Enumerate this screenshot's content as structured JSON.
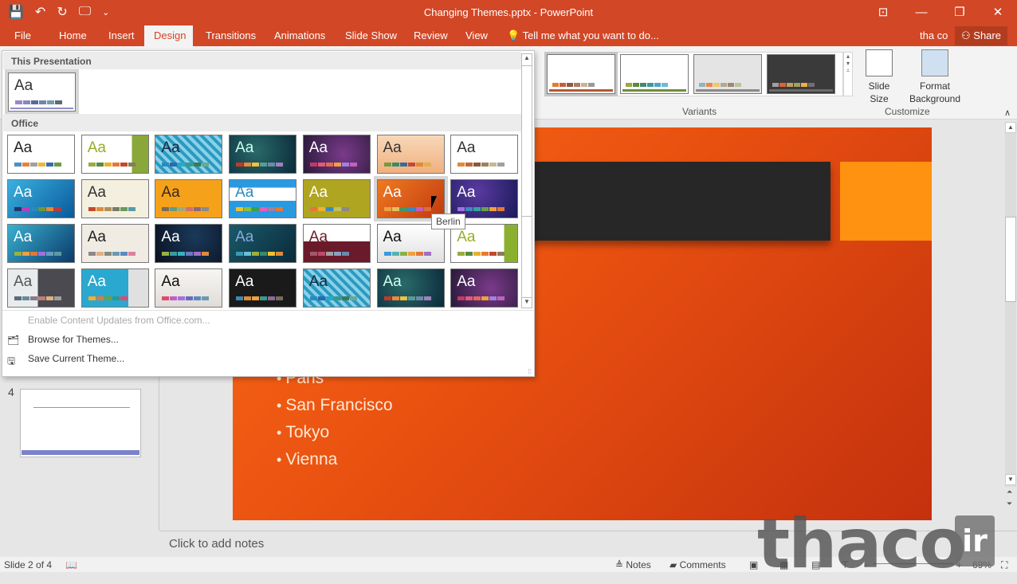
{
  "window": {
    "title": "Changing Themes.pptx - PowerPoint",
    "controls": [
      "ribbon-display-options",
      "minimize",
      "restore",
      "close"
    ]
  },
  "qat": {
    "save": "💾",
    "undo": "↶",
    "redo": "↻",
    "present": "🖵",
    "customize": "⌄"
  },
  "tabs": [
    {
      "label": "File"
    },
    {
      "label": "Home"
    },
    {
      "label": "Insert"
    },
    {
      "label": "Design",
      "active": true
    },
    {
      "label": "Transitions"
    },
    {
      "label": "Animations"
    },
    {
      "label": "Slide Show"
    },
    {
      "label": "Review"
    },
    {
      "label": "View"
    }
  ],
  "tellme": "Tell me what you want to do...",
  "user": "tha co",
  "share": "Share",
  "ribbon": {
    "variants_label": "Variants",
    "customize_label": "Customize",
    "slide_size": "Slide Size",
    "format_background": "Format Background",
    "variants": [
      {
        "bg": "#ffffff",
        "bar": "#b35a36",
        "swatches": [
          "#e87a2c",
          "#c0603a",
          "#8f5a40",
          "#a87d5e",
          "#c8b48f",
          "#999999"
        ]
      },
      {
        "bg": "#ffffff",
        "bar": "#6f8e3a",
        "swatches": [
          "#9aab3f",
          "#5c8a3e",
          "#3e8a72",
          "#3a9a9a",
          "#4aa6c9",
          "#6cb8e0"
        ]
      },
      {
        "bg": "#e4e4e4",
        "bar": "#8a8a8a",
        "swatches": [
          "#8fb4c4",
          "#e88a4a",
          "#f0c86a",
          "#b0a890",
          "#a08870",
          "#c0c0a0"
        ]
      },
      {
        "bg": "#3a3a3a",
        "bar": "#6a6a6a",
        "swatches": [
          "#a0a0a0",
          "#e0603a",
          "#c0a060",
          "#a0a060",
          "#f0b040",
          "#707070"
        ]
      }
    ]
  },
  "gallery": {
    "this_presentation": "This Presentation",
    "office": "Office",
    "current_theme": {
      "bg": "#ffffff",
      "fg": "#333",
      "bar": "#8b8fc8",
      "swatches": [
        "#9a88c8",
        "#8a88c0",
        "#5a6a9a",
        "#6a8aa8",
        "#7a9aa8",
        "#606a78"
      ]
    },
    "themes": [
      {
        "bg": "#ffffff",
        "fg": "#222",
        "swatches": [
          "#4a90c8",
          "#e8823a",
          "#a0a0a0",
          "#f0b830",
          "#3a6ab0",
          "#6a9a4a"
        ]
      },
      {
        "bg": "linear-gradient(90deg,#fff 75%,#8aa83a 75%)",
        "fg": "#9aab2a",
        "swatches": [
          "#9aab3f",
          "#5c8a3e",
          "#e8b030",
          "#e87a30",
          "#c04a30",
          "#8a7a5a"
        ]
      },
      {
        "bg": "repeating-linear-gradient(45deg,#2a9ac0 0 4px,#8ad0e8 4px 8px)",
        "fg": "#1a2a3a",
        "swatches": [
          "#2a8ac0",
          "#2a6ab0",
          "#2aa8c8",
          "#3a9a8a",
          "#3a7a5a",
          "#6aa898"
        ]
      },
      {
        "bg": "radial-gradient(circle at 40% 40%,#2a6a6a,#0a2a3a)",
        "fg": "#cfe",
        "swatches": [
          "#c03a2a",
          "#e88a3a",
          "#f0c040",
          "#5a9a9a",
          "#6a8aa8",
          "#a080c0"
        ]
      },
      {
        "bg": "radial-gradient(circle at 60% 50%,#7a3a8a,#2a1a3a)",
        "fg": "#fff",
        "swatches": [
          "#c03a6a",
          "#e05a7a",
          "#e06a5a",
          "#f0a040",
          "#a080e0",
          "#c060c0"
        ]
      },
      {
        "bg": "linear-gradient(180deg,#f8d8b8,#f0b080)",
        "fg": "#333",
        "swatches": [
          "#7a9a3a",
          "#3a8a6a",
          "#3a6a9a",
          "#c04a3a",
          "#e08a3a",
          "#e0b050"
        ]
      },
      {
        "bg": "#ffffff",
        "fg": "#333",
        "swatches": [
          "#e08a3a",
          "#c06a3a",
          "#8a5a40",
          "#a08060",
          "#c8b890",
          "#a0a0a0"
        ]
      },
      {
        "bg": "linear-gradient(135deg,#3ab0e0,#0a5a9a)",
        "fg": "#fff",
        "swatches": [
          "#1a3a6a",
          "#c03ac0",
          "#2a8ac0",
          "#6a9a3a",
          "#e08a3a",
          "#c03a3a"
        ]
      },
      {
        "bg": "#f4f0e0",
        "fg": "#333",
        "swatches": [
          "#c04a2a",
          "#e08a3a",
          "#b0905a",
          "#7a7a6a",
          "#6a9a5a",
          "#5a9aa8"
        ]
      },
      {
        "bg": "#f5a21a",
        "fg": "#3a2a1a",
        "swatches": [
          "#7a6a5a",
          "#6a9a7a",
          "#9aaa7a",
          "#d07070",
          "#8a6a7a",
          "#8a8a8a"
        ]
      },
      {
        "bg": "linear-gradient(180deg,#2a9ae0 20%,#fff 20%,#fff 55%,#2a9ae0 55%)",
        "fg": "#2a8ac0",
        "swatches": [
          "#f0c030",
          "#8ac03a",
          "#3aa04a",
          "#e060c0",
          "#a080a0",
          "#e07a3a"
        ]
      },
      {
        "bg": "#b0a520",
        "fg": "#fff",
        "swatches": [
          "#e07a3a",
          "#f0b030",
          "#3a8ac0",
          "#c0c060",
          "#8a8a8a"
        ]
      },
      {
        "bg": "linear-gradient(135deg,#f07a20,#c03a10)",
        "fg": "#fff",
        "swatches": [
          "#f0a040",
          "#e0c060",
          "#3a9a6a",
          "#3a8ac0",
          "#c060c0",
          "#e06a3a"
        ]
      },
      {
        "bg": "radial-gradient(circle at 40% 30%,#5a3aa0,#1a1a5a)",
        "fg": "#fff",
        "swatches": [
          "#a070e0",
          "#3a8ac0",
          "#3aa0a0",
          "#6aa04a",
          "#f0a040",
          "#e07a3a"
        ]
      },
      {
        "bg": "linear-gradient(135deg,#3ab0d0,#0a3a6a)",
        "fg": "#fff",
        "swatches": [
          "#9ab040",
          "#f0a040",
          "#e07a3a",
          "#a070e0",
          "#6a9ac0",
          "#5a9aa0"
        ]
      },
      {
        "bg": "#f0ece4",
        "fg": "#222",
        "swatches": [
          "#8a8a8a",
          "#e0b080",
          "#8a8a7a",
          "#6a9ab0",
          "#5a8ac0",
          "#e080a0"
        ]
      },
      {
        "bg": "radial-gradient(circle at 60% 30%,#1a3a5a,#0a1020)",
        "fg": "#fff",
        "swatches": [
          "#9ab040",
          "#3a9aa0",
          "#3ab0c0",
          "#6a7ac0",
          "#a070c0",
          "#e08a3a"
        ]
      },
      {
        "bg": "linear-gradient(135deg,#1a5a6a,#0a2a3a)",
        "fg": "#8ad",
        "swatches": [
          "#3a9ab0",
          "#6ac0d0",
          "#9ab040",
          "#3a8a6a",
          "#f0c030",
          "#e08a3a"
        ]
      },
      {
        "bg": "linear-gradient(180deg,#fff 45%,#6a1a2a 45%)",
        "fg": "#6a1a2a",
        "swatches": [
          "#a05a6a",
          "#c04a6a",
          "#a0a0a0",
          "#8aa0c0",
          "#6a8ab0"
        ]
      },
      {
        "bg": "linear-gradient(180deg,#fff,#e0e0e0)",
        "fg": "#111",
        "swatches": [
          "#3a9ae0",
          "#5ab0b0",
          "#8ab04a",
          "#f0a040",
          "#e07a3a",
          "#a070c0"
        ]
      },
      {
        "bg": "linear-gradient(90deg,#fff 80%,#8ab030 80%)",
        "fg": "#9aab2a",
        "swatches": [
          "#9aab3f",
          "#5c8a3e",
          "#e8b030",
          "#e87a30",
          "#c04a30",
          "#8a7a5a"
        ]
      },
      {
        "bg": "linear-gradient(90deg,#e8ecec 45%,#4a4a50 45%)",
        "fg": "#555",
        "swatches": [
          "#5a6a7a",
          "#6a8a9a",
          "#8a7a8a",
          "#c07a7a",
          "#e0b080",
          "#a0a0a0"
        ]
      },
      {
        "bg": "linear-gradient(90deg,#2aa8d0 70%,#e0e0e0 70%)",
        "fg": "#fff",
        "swatches": [
          "#f0b030",
          "#e07a3a",
          "#6aa040",
          "#2a9a8a",
          "#e04a6a"
        ]
      },
      {
        "bg": "linear-gradient(180deg,#f8f6f4,#e0dcd8)",
        "fg": "#111",
        "swatches": [
          "#e04a6a",
          "#c060c0",
          "#a070e0",
          "#6a6ac0",
          "#5a8ac0",
          "#6a9ab0"
        ]
      },
      {
        "bg": "#1a1a1a",
        "fg": "#fff",
        "swatches": [
          "#3a8ab0",
          "#e08a3a",
          "#f0a040",
          "#3a9a8a",
          "#8a6a9a",
          "#7a6a5a"
        ]
      },
      {
        "bg": "repeating-linear-gradient(45deg,#2a9ac0 0 4px,#8ad0e8 4px 8px)",
        "fg": "#1a2a3a",
        "swatches": [
          "#2a8ac0",
          "#2a6ab0",
          "#2aa8c8",
          "#3a9a8a",
          "#3a7a5a",
          "#6aa898"
        ]
      },
      {
        "bg": "radial-gradient(circle at 40% 40%,#2a6a6a,#0a2a3a)",
        "fg": "#cfe",
        "swatches": [
          "#c03a2a",
          "#e88a3a",
          "#f0c040",
          "#5a9a9a",
          "#6a8aa8",
          "#a080c0"
        ]
      },
      {
        "bg": "radial-gradient(circle at 60% 50%,#7a3a8a,#2a1a3a)",
        "fg": "#fff",
        "swatches": [
          "#c03a6a",
          "#e05a7a",
          "#e06a5a",
          "#f0a040",
          "#a080e0",
          "#c060c0"
        ]
      }
    ],
    "aa_text": "Aa",
    "hover_tooltip": "Berlin",
    "menu": {
      "enable_updates": "Enable Content Updates from Office.com...",
      "browse": "Browse for Themes...",
      "save": "Save Current Theme..."
    }
  },
  "slides_pane": {
    "visible_number": "4"
  },
  "slide": {
    "bullets": [
      "Paris",
      "San Francisco",
      "Tokyo",
      "Vienna"
    ]
  },
  "notes": {
    "placeholder": "Click to add notes"
  },
  "status": {
    "slide_info": "Slide 2 of 4",
    "notes": "Notes",
    "comments": "Comments",
    "zoom": "69%",
    "zoom_minus": "-",
    "zoom_plus": "+"
  },
  "watermark": {
    "text": "thaco",
    "suffix": "ir"
  }
}
